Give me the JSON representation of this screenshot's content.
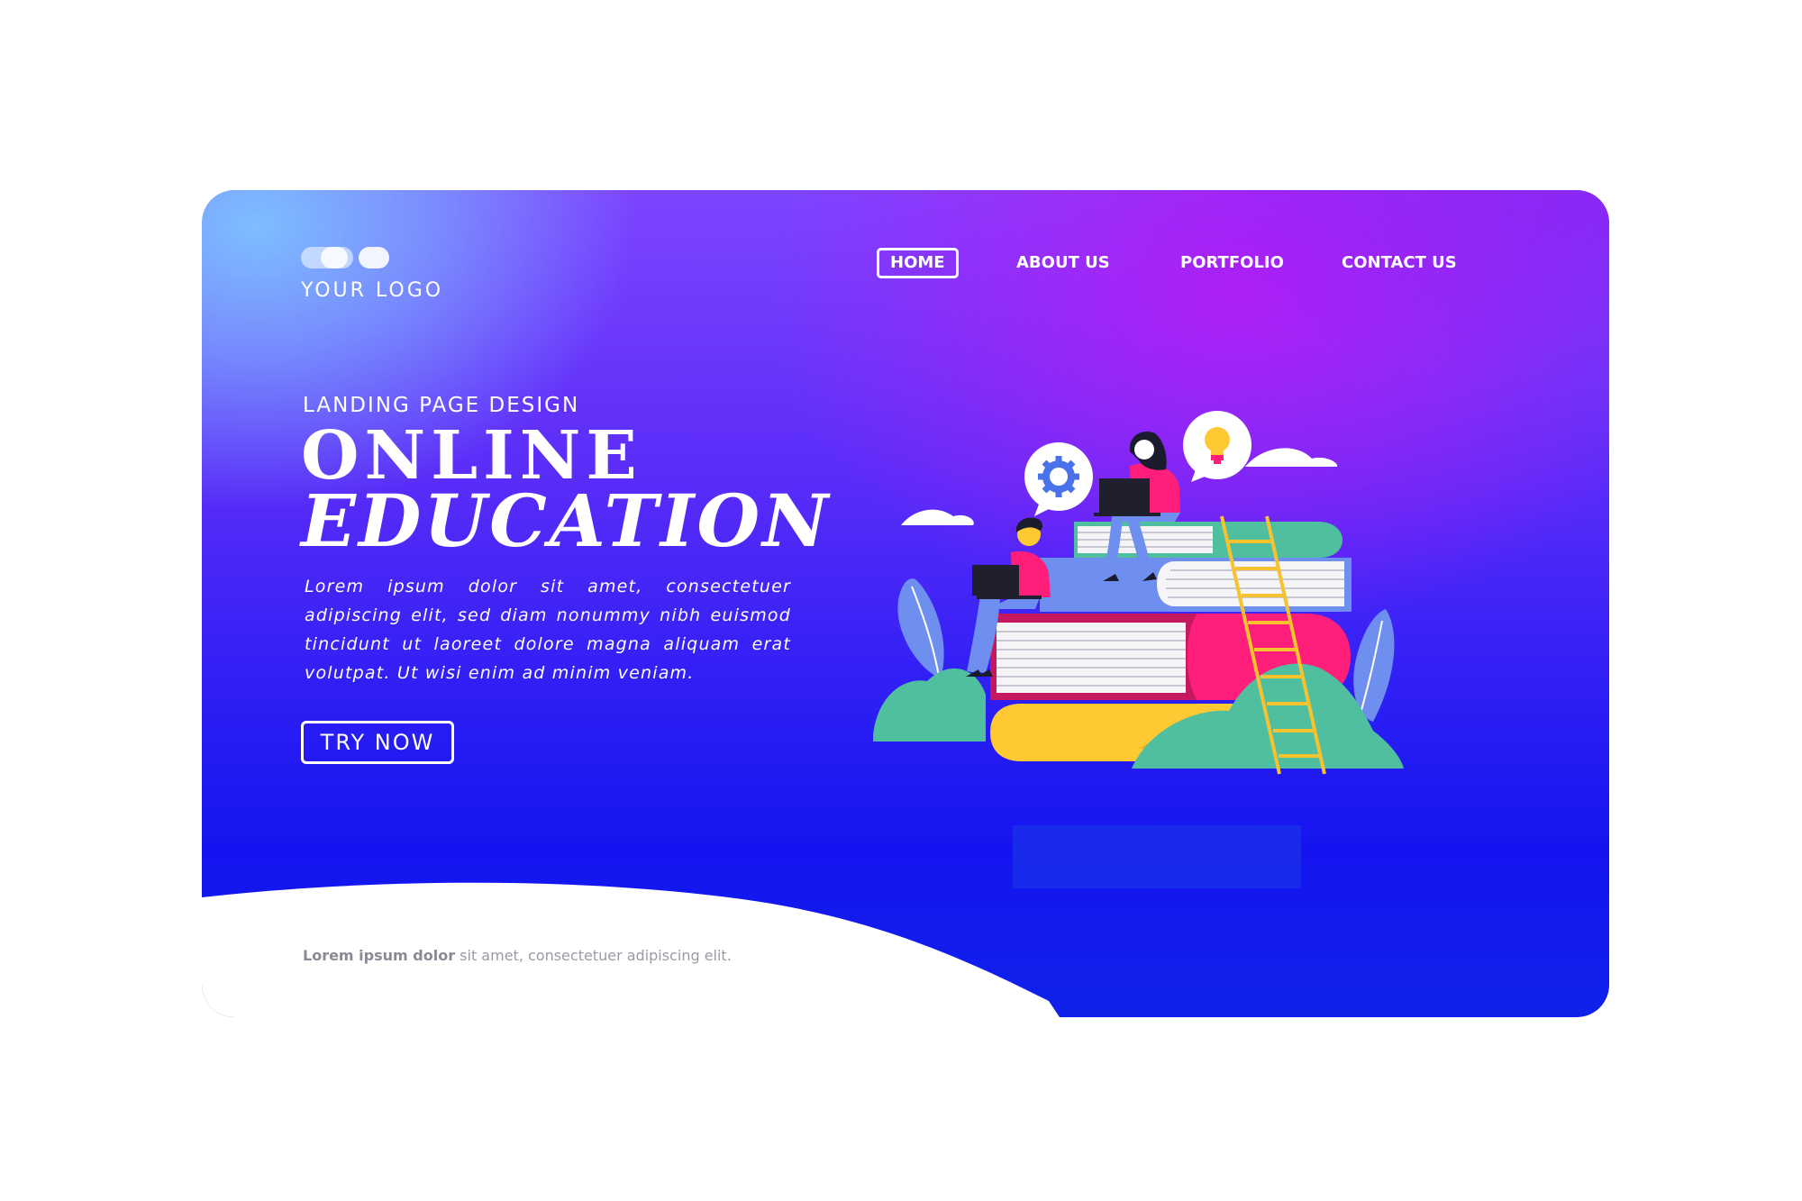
{
  "logo": {
    "text": "YOUR LOGO"
  },
  "nav": {
    "items": [
      {
        "label": "HOME",
        "active": true
      },
      {
        "label": "ABOUT US",
        "active": false
      },
      {
        "label": "PORTFOLIO",
        "active": false
      },
      {
        "label": "CONTACT US",
        "active": false
      }
    ]
  },
  "hero": {
    "eyebrow": "LANDING PAGE DESIGN",
    "title_line1": "ONLINE",
    "title_line2": "EDUCATION",
    "description": "Lorem ipsum dolor sit amet, consectetuer adipiscing elit, sed diam nonummy nibh euismod tincidunt ut laoreet dolore magna aliquam erat volutpat. Ut wisi enim ad minim veniam.",
    "cta_label": "TRY NOW"
  },
  "footer": {
    "bold": "Lorem ipsum dolor",
    "rest": " sit amet, consectetuer adipiscing elit."
  },
  "colors": {
    "accent_purple": "#a81cf5",
    "deep_blue": "#1414f0",
    "book_pink": "#ff1f7a",
    "book_yellow": "#ffc933",
    "book_teal": "#4fbfa0",
    "book_blue": "#6f8ff0",
    "ladder_yellow": "#f7c230"
  },
  "icons": [
    "gear-icon",
    "lightbulb-icon",
    "laptop-icon"
  ]
}
